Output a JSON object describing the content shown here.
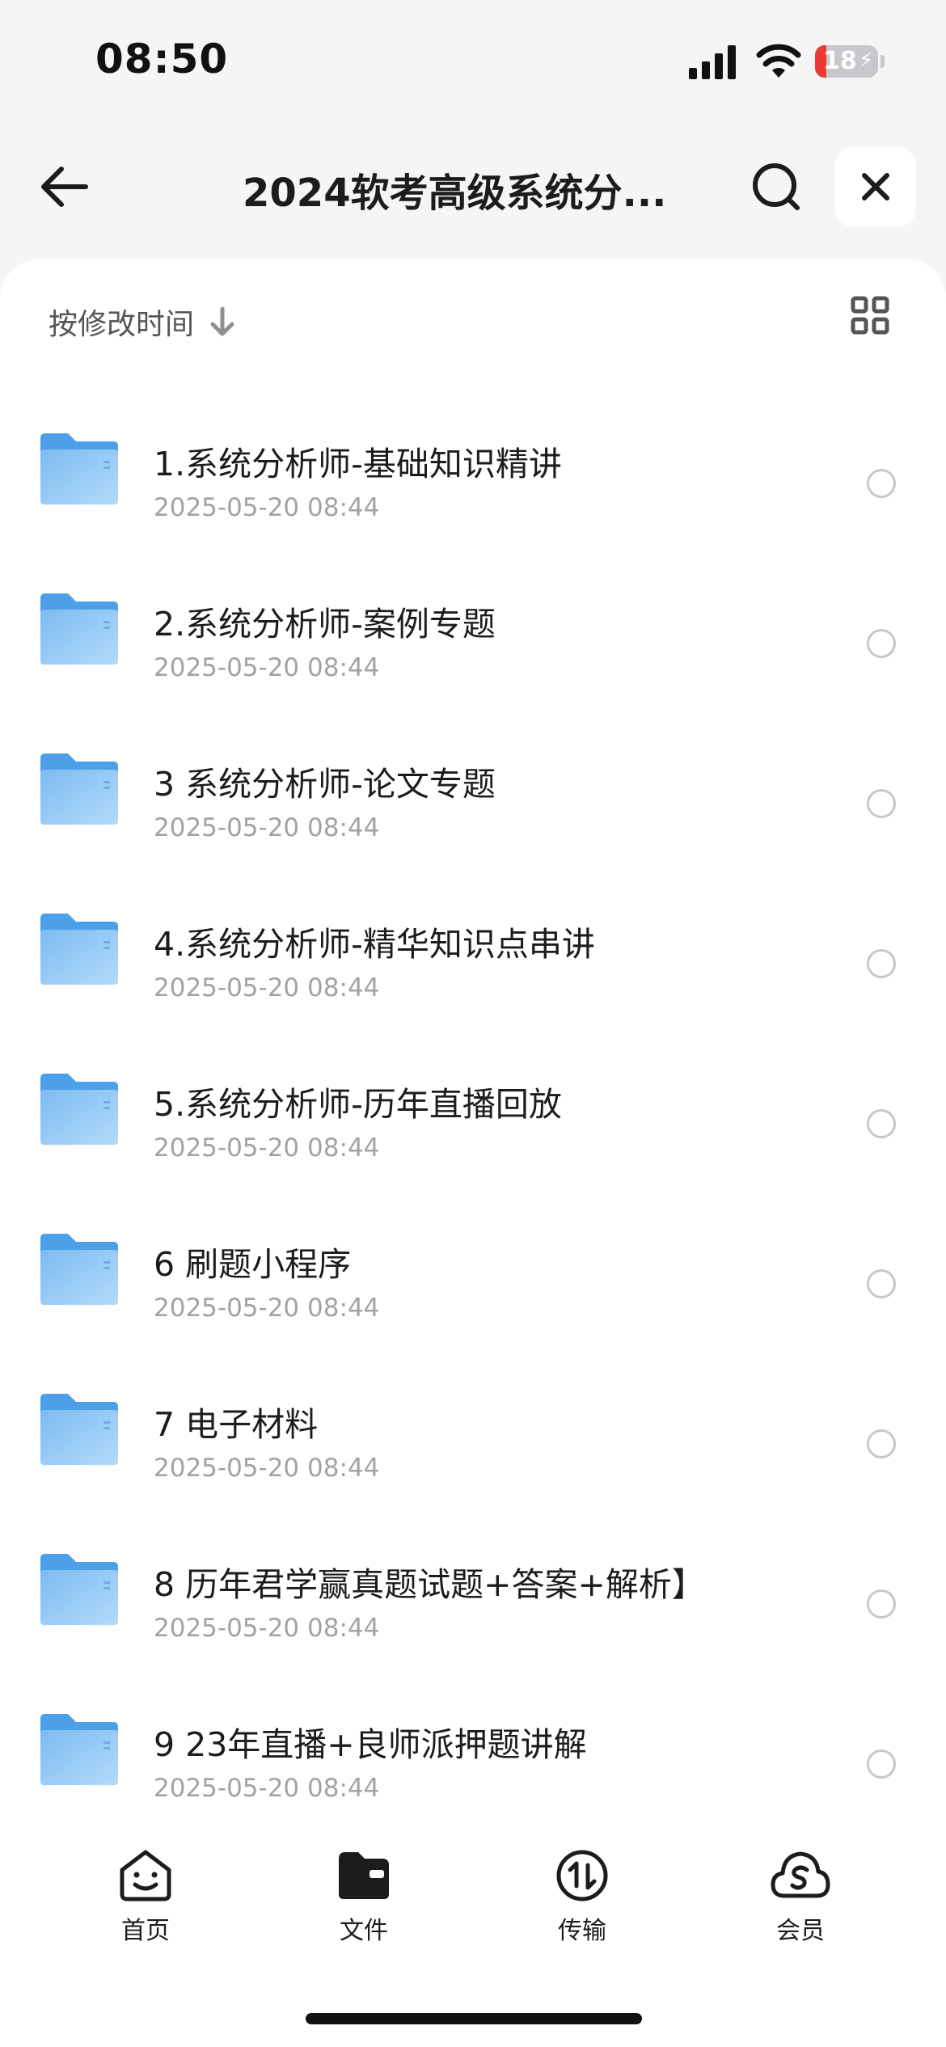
{
  "status_bar": {
    "time": "08:50",
    "battery": "18",
    "battery_level": 0.18
  },
  "header": {
    "title": "2024软考高级系统分...",
    "back_icon": "arrow-left-icon",
    "search_icon": "search-icon",
    "close_icon": "close-icon"
  },
  "sort": {
    "label": "按修改时间",
    "arrow_icon": "arrow-down-icon",
    "view_icon": "grid-view-icon"
  },
  "files": [
    {
      "name": "1.系统分析师-基础知识精讲",
      "date": "2025-05-20 08:44"
    },
    {
      "name": "2.系统分析师-案例专题",
      "date": "2025-05-20 08:44"
    },
    {
      "name": "3 系统分析师-论文专题",
      "date": "2025-05-20 08:44"
    },
    {
      "name": "4.系统分析师-精华知识点串讲",
      "date": "2025-05-20 08:44"
    },
    {
      "name": "5.系统分析师-历年直播回放",
      "date": "2025-05-20 08:44"
    },
    {
      "name": "6 刷题小程序",
      "date": "2025-05-20 08:44"
    },
    {
      "name": "7 电子材料",
      "date": "2025-05-20 08:44"
    },
    {
      "name": "8 历年君学赢真题试题+答案+解析】",
      "date": "2025-05-20 08:44"
    },
    {
      "name": "9 23年直播+良师派押题讲解",
      "date": "2025-05-20 08:44"
    }
  ],
  "tabs": [
    {
      "label": "首页",
      "icon": "smiley-home-icon"
    },
    {
      "label": "文件",
      "icon": "folder-file-icon"
    },
    {
      "label": "传输",
      "icon": "transfer-icon"
    },
    {
      "label": "会员",
      "icon": "cloud-vip-icon"
    }
  ],
  "colors": {
    "folder": "#5aa8ec",
    "folder_light": "#a9d4f8",
    "battery_low": "#ea3a32",
    "page_bg": "#f5f5f5",
    "text_primary": "#1c1c1e",
    "text_secondary": "#a2a2a8"
  }
}
